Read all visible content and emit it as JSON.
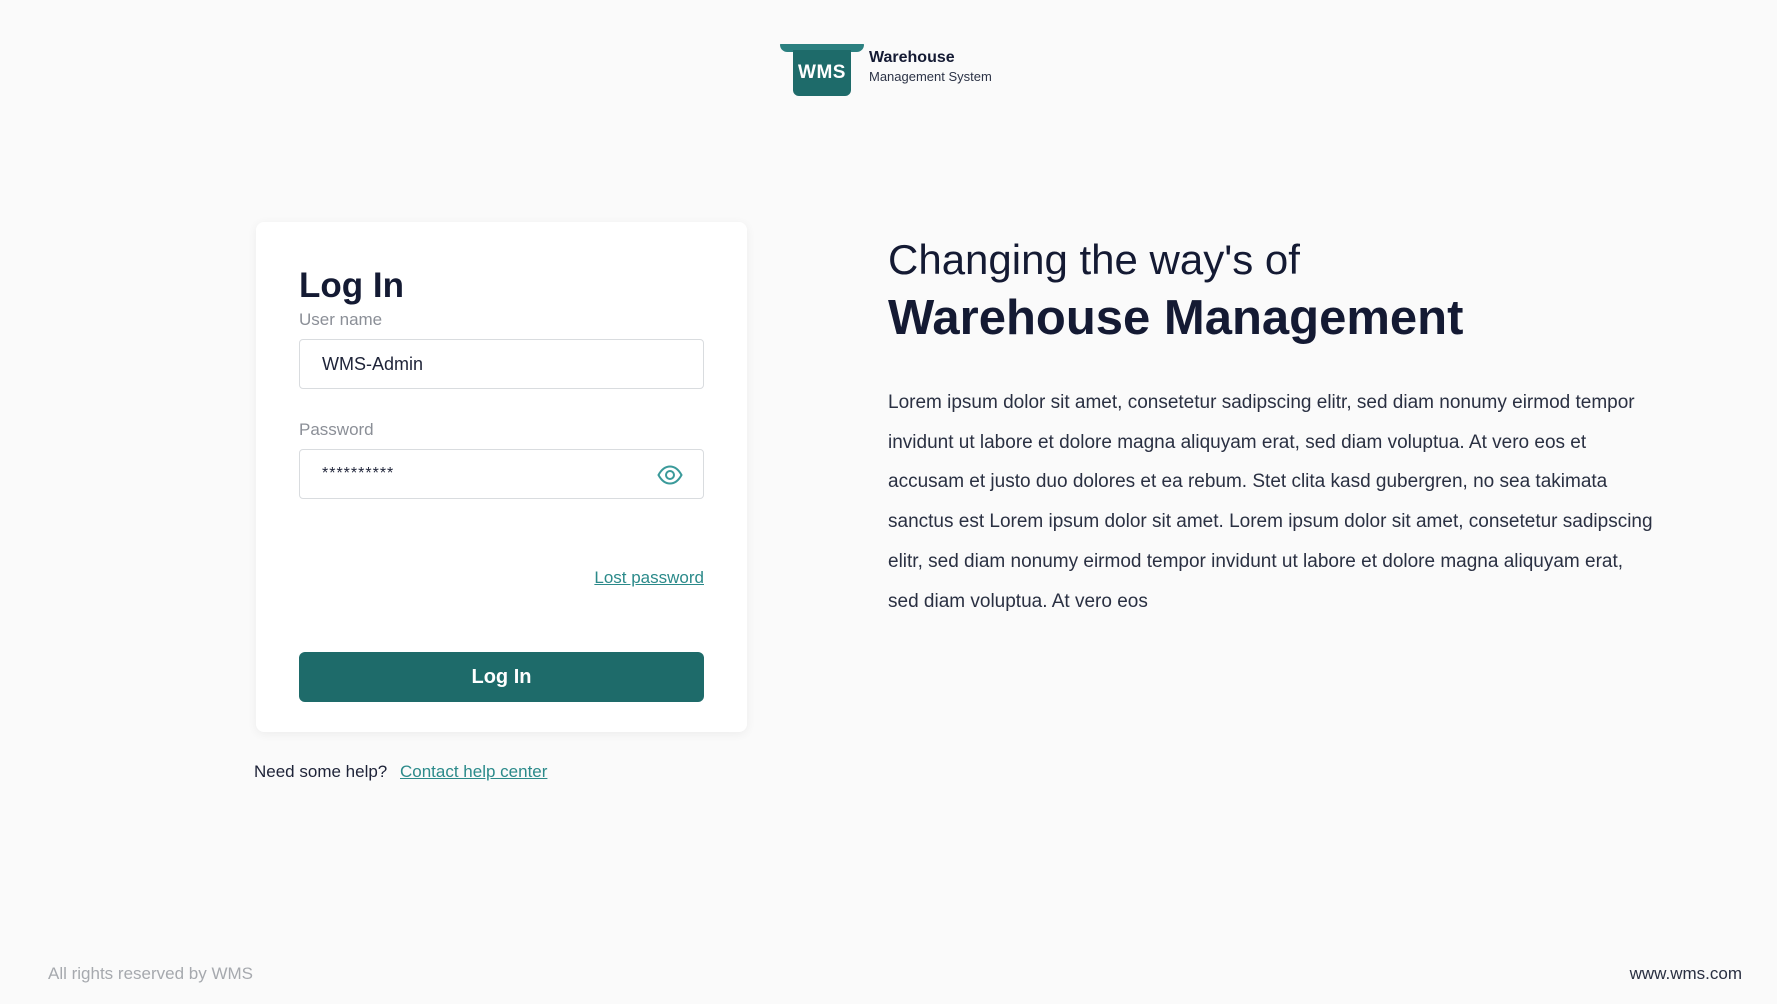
{
  "brand": {
    "logo_text": "WMS",
    "title": "Warehouse",
    "subtitle": "Management System",
    "accent": "#1e6b6a",
    "link_color": "#2b8a8a"
  },
  "login": {
    "title": "Log In",
    "username_label": "User name",
    "username_value": "WMS-Admin",
    "password_label": "Password",
    "password_value": "**********",
    "lost_password": "Lost password",
    "submit_label": "Log In"
  },
  "help": {
    "prompt": "Need some help?",
    "link": "Contact help center"
  },
  "hero": {
    "line1": "Changing the way's of",
    "line2": "Warehouse Management",
    "body": "Lorem ipsum dolor sit amet, consetetur sadipscing elitr, sed diam nonumy eirmod tempor invidunt ut labore et dolore magna aliquyam erat, sed diam voluptua. At vero eos et accusam et justo duo dolores et ea rebum. Stet clita kasd gubergren, no sea takimata sanctus est Lorem ipsum dolor sit amet. Lorem ipsum dolor sit amet, consetetur sadipscing elitr, sed diam nonumy eirmod tempor invidunt ut labore et dolore magna aliquyam erat, sed diam voluptua. At vero eos"
  },
  "footer": {
    "copyright": "All rights reserved by WMS",
    "website": "www.wms.com"
  },
  "icons": {
    "password_toggle": "eye-icon"
  }
}
